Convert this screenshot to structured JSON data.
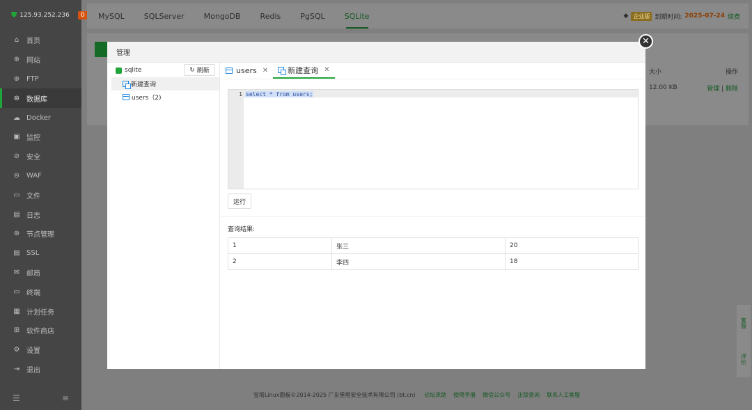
{
  "sidebar": {
    "ip": "125.93.252.236",
    "badge": "0",
    "items": [
      {
        "icon": "⌂",
        "label": "首页"
      },
      {
        "icon": "⊕",
        "label": "网站"
      },
      {
        "icon": "⊕",
        "label": "FTP"
      },
      {
        "icon": "⊜",
        "label": "数据库"
      },
      {
        "icon": "☁",
        "label": "Docker"
      },
      {
        "icon": "▣",
        "label": "监控"
      },
      {
        "icon": "⊘",
        "label": "安全"
      },
      {
        "icon": "⊜",
        "label": "WAF"
      },
      {
        "icon": "▭",
        "label": "文件"
      },
      {
        "icon": "▤",
        "label": "日志"
      },
      {
        "icon": "⊛",
        "label": "节点管理"
      },
      {
        "icon": "▤",
        "label": "SSL"
      },
      {
        "icon": "✉",
        "label": "邮局"
      },
      {
        "icon": "▭",
        "label": "终端"
      },
      {
        "icon": "▦",
        "label": "计划任务"
      },
      {
        "icon": "⊞",
        "label": "软件商店"
      },
      {
        "icon": "⚙",
        "label": "设置"
      },
      {
        "icon": "⇥",
        "label": "退出"
      }
    ]
  },
  "topbar": {
    "tabs": [
      "MySQL",
      "SQLServer",
      "MongoDB",
      "Redis",
      "PgSQL",
      "SQLite"
    ],
    "vip_label": "企业版",
    "expire_label": "到期时间:",
    "expire_date": "2025-07-24",
    "renew_label": "续费"
  },
  "bg_table": {
    "size_header": "大小",
    "action_header": "操作",
    "size_value": "12.00 KB",
    "manage_link": "管理",
    "delete_link": "删除"
  },
  "float_panel": {
    "service": "客服",
    "review": "评价"
  },
  "footer": {
    "copyright": "宝塔Linux面板©2014-2025 广东堡塔安全技术有限公司 (bt.cn)",
    "links": [
      "论坛求助",
      "使用手册",
      "微信公众号",
      "正版查询",
      "联系人工客服"
    ]
  },
  "modal": {
    "title": "管理",
    "tree": {
      "root": "sqlite",
      "refresh": "刷新",
      "items": [
        "新建查询",
        "users（2)"
      ]
    },
    "tabs": [
      "users",
      "新建查询"
    ],
    "editor": {
      "line": "1",
      "code": "select * from users;"
    },
    "run_label": "运行",
    "result_label": "查询结果:",
    "rows": [
      [
        "1",
        "张三",
        "20"
      ],
      [
        "2",
        "李四",
        "18"
      ]
    ]
  },
  "colors": {
    "accent": "#20a53a",
    "overlay": "#7f7f7f",
    "link_blue": "#1e88e5"
  }
}
